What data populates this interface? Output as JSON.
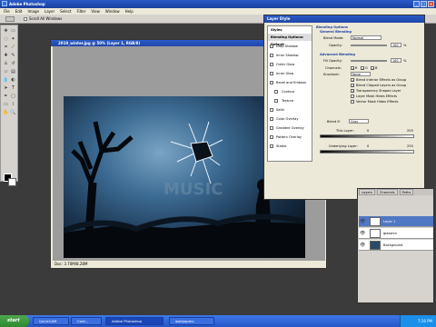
{
  "app": {
    "title": "Adobe Photoshop"
  },
  "menu": [
    "File",
    "Edit",
    "Image",
    "Layer",
    "Select",
    "Filter",
    "View",
    "Window",
    "Help"
  ],
  "options_bar": {
    "scroll_all_windows": "Scroll All Windows"
  },
  "document": {
    "title": "2019_winter.jpg @ 50% (Layer 1, RGB/8)",
    "status": "Doc: 3.70M/8.28M"
  },
  "layer_style": {
    "title": "Layer Style",
    "styles_header": "Styles",
    "styles": [
      {
        "label": "Blending Options: Default",
        "selected": true
      },
      {
        "label": "Drop Shadow"
      },
      {
        "label": "Inner Shadow"
      },
      {
        "label": "Outer Glow"
      },
      {
        "label": "Inner Glow"
      },
      {
        "label": "Bevel and Emboss"
      },
      {
        "label": "Contour"
      },
      {
        "label": "Texture"
      },
      {
        "label": "Satin"
      },
      {
        "label": "Color Overlay"
      },
      {
        "label": "Gradient Overlay"
      },
      {
        "label": "Pattern Overlay"
      },
      {
        "label": "Stroke"
      }
    ],
    "blending": {
      "section_title": "Blending Options",
      "general_title": "General Blending",
      "blend_mode_label": "Blend Mode:",
      "blend_mode_value": "Normal",
      "opacity_label": "Opacity:",
      "opacity_value": "100",
      "advanced_title": "Advanced Blending",
      "fill_opacity_label": "Fill Opacity:",
      "fill_opacity_value": "100",
      "channels_label": "Channels:",
      "channel_r": "R",
      "channel_g": "G",
      "channel_b": "B",
      "knockout_label": "Knockout:",
      "knockout_value": "None",
      "chk1": "Blend Interior Effects as Group",
      "chk2": "Blend Clipped Layers as Group",
      "chk3": "Transparency Shapes Layer",
      "chk4": "Layer Mask Hides Effects",
      "chk5": "Vector Mask Hides Effects",
      "blend_if_label": "Blend If:",
      "blend_if_value": "Gray",
      "this_layer_label": "This Layer:",
      "this_layer_min": "0",
      "this_layer_max": "255",
      "underlying_label": "Underlying Layer:",
      "underlying_min": "0",
      "underlying_max": "255"
    }
  },
  "layers_panel": {
    "tabs": [
      "Layers",
      "Channels",
      "Paths"
    ],
    "layers": [
      {
        "name": "Layer 1",
        "selected": true
      },
      {
        "name": "glassfxn"
      },
      {
        "name": "Background"
      }
    ]
  },
  "taskbar": {
    "start": "start",
    "buttons": [
      "QuickCAM",
      "Conf...",
      "Adobe Photoshop",
      "wallpapers"
    ],
    "time": "7:16 PM"
  },
  "image_text": {
    "word": "MUSIC"
  },
  "colors": {
    "accent": "#2a5bc8",
    "title_blue": "#1a3fa0"
  }
}
